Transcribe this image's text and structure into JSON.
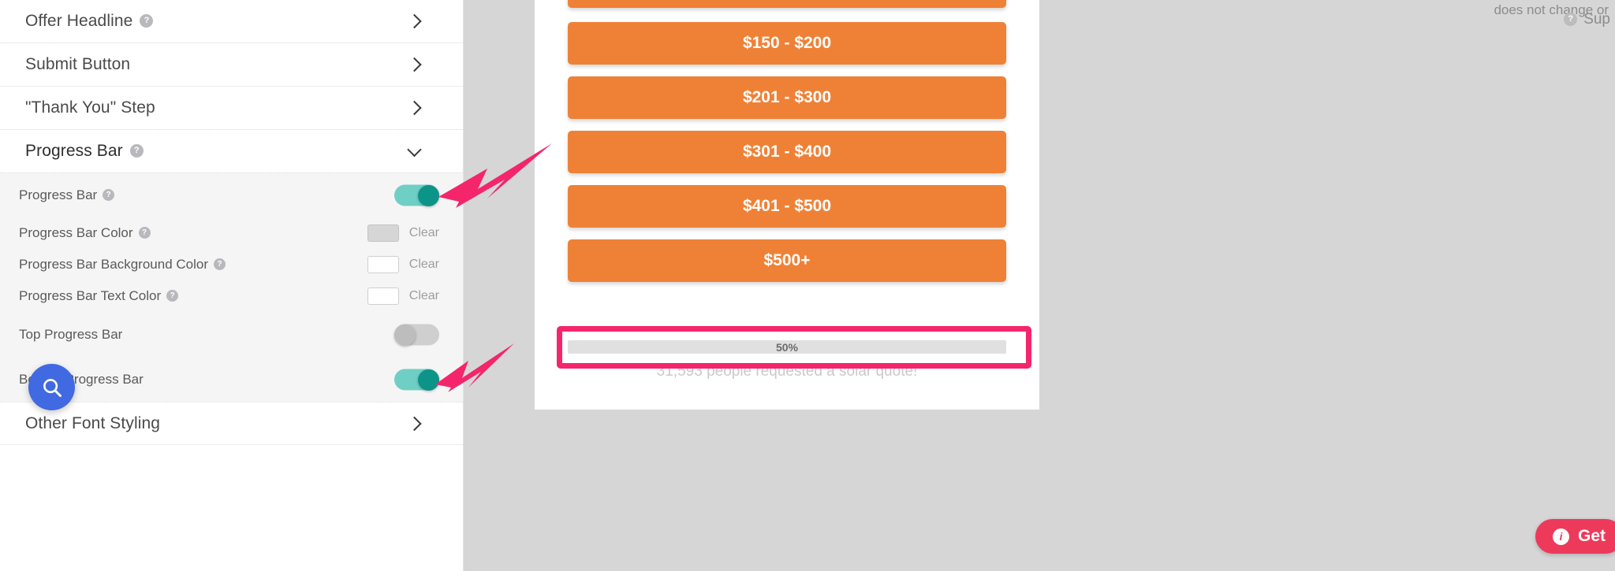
{
  "sidebar": {
    "accordion": [
      {
        "label": "Offer Headline",
        "help": "?",
        "chevron": "chevron-right-icon",
        "expanded": false
      },
      {
        "label": "Submit Button",
        "help": "",
        "chevron": "chevron-right-icon",
        "expanded": false
      },
      {
        "label": "\"Thank You\" Step",
        "help": "",
        "chevron": "chevron-right-icon",
        "expanded": false
      },
      {
        "label": "Progress Bar",
        "help": "?",
        "chevron": "chevron-down-icon",
        "expanded": true
      }
    ],
    "settings": [
      {
        "label": "Progress Bar",
        "help": "?",
        "control": "toggle",
        "value": "on"
      },
      {
        "label": "Progress Bar Color",
        "help": "?",
        "control": "color",
        "swatch": "filled",
        "clear_label": "Clear"
      },
      {
        "label": "Progress Bar Background Color",
        "help": "?",
        "control": "color",
        "swatch": "empty",
        "clear_label": "Clear"
      },
      {
        "label": "Progress Bar Text Color",
        "help": "?",
        "control": "color",
        "swatch": "empty",
        "clear_label": "Clear"
      },
      {
        "label": "Top Progress Bar",
        "help": "",
        "control": "toggle",
        "value": "off"
      },
      {
        "label": "Bottom Progress Bar",
        "help": "",
        "control": "toggle",
        "value": "on"
      }
    ],
    "footer_accordion": [
      {
        "label": "Other Font Styling",
        "help": "",
        "chevron": "chevron-right-icon",
        "expanded": false
      }
    ],
    "fab": {
      "icon": "search-icon"
    }
  },
  "preview": {
    "price_buttons": [
      {
        "label": "",
        "clipped": true
      },
      {
        "label": "$150 - $200"
      },
      {
        "label": "$201 - $300"
      },
      {
        "label": "$301 - $400"
      },
      {
        "label": "$401 - $500"
      },
      {
        "label": "$500+"
      }
    ],
    "progress": {
      "percent_label": "50%",
      "percent_value": 50,
      "caption": "31,593 people requested a solar quote!"
    }
  },
  "annotations": {
    "arrow_toggle_progress_bar": "pink-arrow-icon",
    "arrow_toggle_bottom_progress_bar": "pink-arrow-icon",
    "callout_rect": "pink-highlight-box"
  },
  "right_panel": {
    "note_text": "does not change or",
    "support_label": "Sup",
    "support_help": "?",
    "get_button_label": "Get",
    "get_button_icon": "info-icon"
  },
  "colors": {
    "orange": "#ef8136",
    "pink": "#f4256b",
    "teal": "#0d9488",
    "blue": "#4169e1",
    "red": "#ed3a5b"
  }
}
